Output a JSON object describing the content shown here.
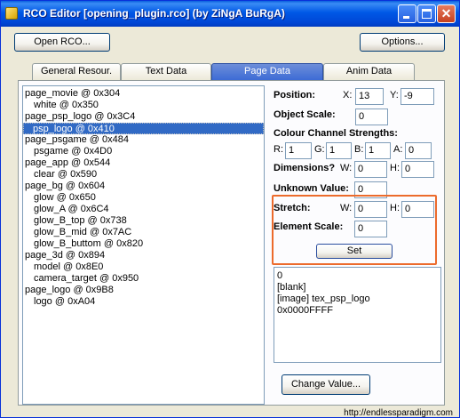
{
  "window": {
    "title": "RCO Editor [opening_plugin.rco] (by ZiNgA BuRgA)"
  },
  "toolbar": {
    "open_label": "Open RCO...",
    "options_label": "Options..."
  },
  "tabs": [
    "General Resour.",
    "Text Data",
    "Page Data",
    "Anim Data"
  ],
  "tree": [
    "page_movie @ 0x304",
    "white @ 0x350",
    "page_psp_logo @ 0x3C4",
    "psp_logo @ 0x410",
    "page_psgame @ 0x484",
    "psgame @ 0x4D0",
    "page_app @ 0x544",
    "clear @ 0x590",
    "page_bg @ 0x604",
    "glow @ 0x650",
    "glow_A @ 0x6C4",
    "glow_B_top @ 0x738",
    "glow_B_mid @ 0x7AC",
    "glow_B_buttom @ 0x820",
    "page_3d @ 0x894",
    "model @ 0x8E0",
    "camera_target @ 0x950",
    "page_logo @ 0x9B8",
    "logo @ 0xA04"
  ],
  "props": {
    "position_label": "Position:",
    "x_label": "X:",
    "x_value": "13",
    "y_label": "Y:",
    "y_value": "-9",
    "object_scale_label": "Object Scale:",
    "object_scale_value": "0",
    "colour_label": "Colour Channel Strengths:",
    "r_label": "R:",
    "r_value": "1",
    "g_label": "G:",
    "g_value": "1",
    "b_label": "B:",
    "b_value": "1",
    "a_label": "A:",
    "a_value": "0",
    "dimensions_label": "Dimensions?",
    "dim_w_label": "W:",
    "dim_w_value": "0",
    "dim_h_label": "H:",
    "dim_h_value": "0",
    "unknown_label": "Unknown Value:",
    "unknown_value": "0",
    "stretch_label": "Stretch:",
    "stretch_w_label": "W:",
    "stretch_w_value": "0",
    "stretch_h_label": "H:",
    "stretch_h_value": "0",
    "element_scale_label": "Element Scale:",
    "element_scale_value": "0",
    "set_label": "Set"
  },
  "value_box": [
    "0",
    "[blank]",
    "[image] tex_psp_logo",
    "0x0000FFFF"
  ],
  "change_label": "Change Value...",
  "status": "http://endlessparadigm.com"
}
